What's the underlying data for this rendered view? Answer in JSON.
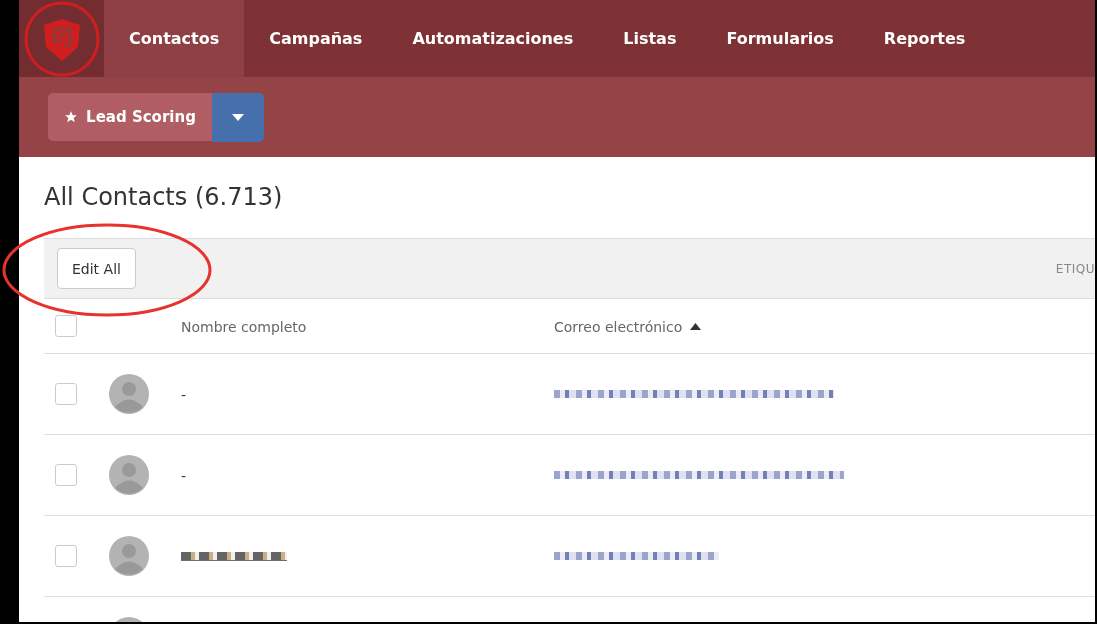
{
  "nav": {
    "items": [
      {
        "label": "Contactos",
        "selected": true
      },
      {
        "label": "Campañas",
        "selected": false
      },
      {
        "label": "Automatizaciones",
        "selected": false
      },
      {
        "label": "Listas",
        "selected": false
      },
      {
        "label": "Formularios",
        "selected": false
      },
      {
        "label": "Reportes",
        "selected": false
      }
    ]
  },
  "toolbar": {
    "button": "Lead Scoring"
  },
  "page": {
    "title": "All Contacts (6.713)"
  },
  "bulk_bar": {
    "button": "Edit All",
    "column_3": "ETIQU"
  },
  "table": {
    "header_checked": false,
    "columns": [
      {
        "label": "Nombre completo",
        "sorted": false
      },
      {
        "label": "Correo electrónico",
        "sorted": true
      }
    ],
    "rows": [
      {
        "checked": false,
        "name": {
          "kind": "text",
          "text": "-"
        },
        "email": {
          "kind": "redacted"
        }
      },
      {
        "checked": false,
        "name": {
          "kind": "text",
          "text": "-"
        },
        "email": {
          "kind": "redacted"
        }
      },
      {
        "checked": false,
        "name": {
          "kind": "redacted"
        },
        "email": {
          "kind": "redacted"
        }
      }
    ]
  }
}
